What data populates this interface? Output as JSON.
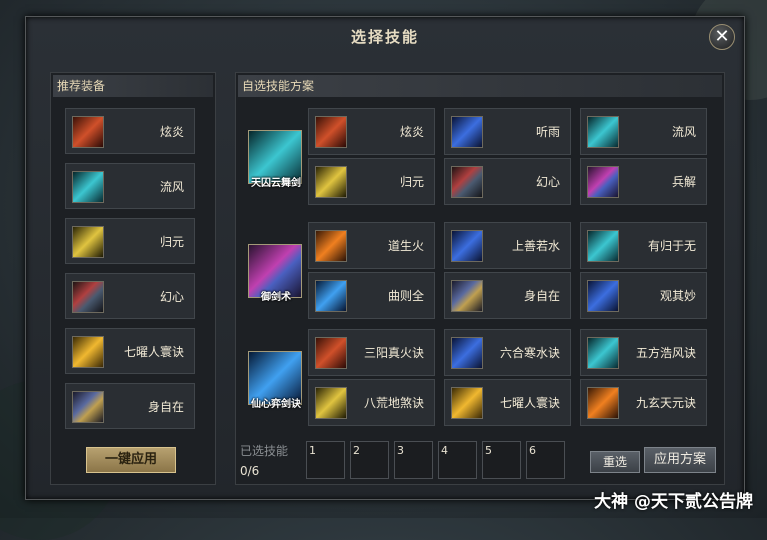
{
  "dialog": {
    "title": "选择技能"
  },
  "left_panel": {
    "header": "推荐装备",
    "items": [
      {
        "label": "炫炎",
        "icon": "flame-blade-icon"
      },
      {
        "label": "流风",
        "icon": "wind-sword-icon"
      },
      {
        "label": "归元",
        "icon": "golden-sword-icon"
      },
      {
        "label": "幻心",
        "icon": "dark-sword-icon"
      },
      {
        "label": "七曜人寰诀",
        "icon": "golden-armor-icon"
      },
      {
        "label": "身自在",
        "icon": "sword-gate-icon"
      }
    ],
    "apply_button": "一键应用"
  },
  "right_panel": {
    "header": "自选技能方案",
    "schemes": [
      {
        "name": "天囚云舞剑",
        "skills": [
          "炫炎",
          "听雨",
          "流风",
          "归元",
          "幻心",
          "兵解"
        ]
      },
      {
        "name": "御剑术",
        "skills": [
          "道生火",
          "上善若水",
          "有归于无",
          "曲则全",
          "身自在",
          "观其妙"
        ]
      },
      {
        "name": "仙心弈剑诀",
        "skills": [
          "三阳真火诀",
          "六合寒水诀",
          "五方浩风诀",
          "八荒地煞诀",
          "七曜人寰诀",
          "九玄天元诀"
        ]
      }
    ],
    "selected": {
      "label": "已选技能",
      "count": "0/6",
      "slots": [
        "1",
        "2",
        "3",
        "4",
        "5",
        "6"
      ]
    },
    "reset_button": "重选",
    "apply_button": "应用方案"
  },
  "watermark": "大神 @天下贰公告牌"
}
